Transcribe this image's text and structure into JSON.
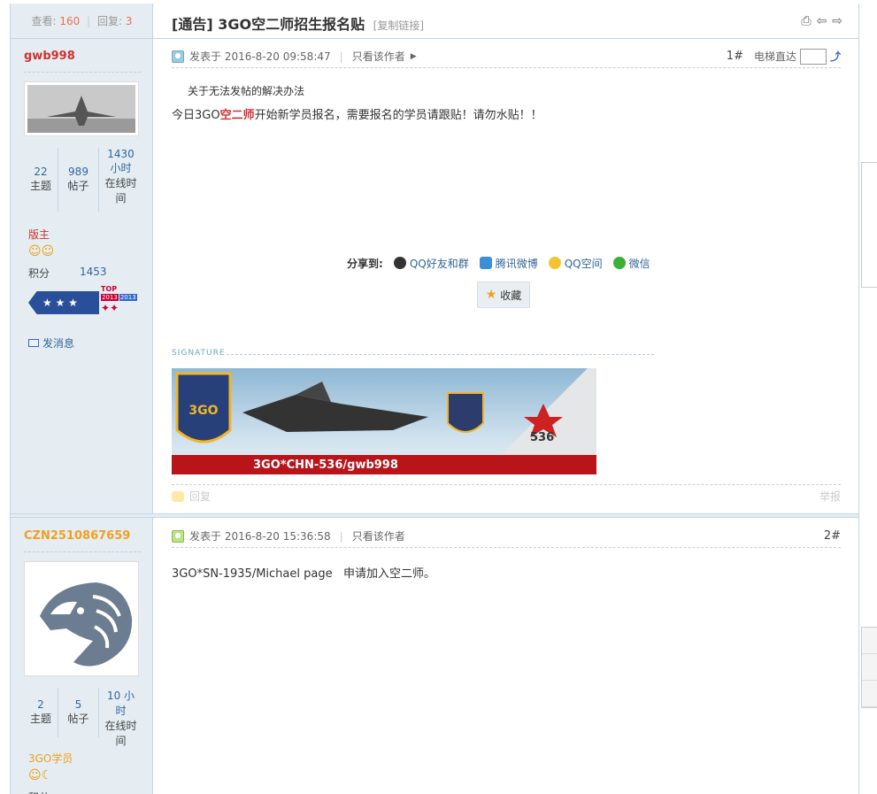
{
  "thread": {
    "views_label": "查看:",
    "views": "160",
    "replies_label": "回复:",
    "replies": "3",
    "tag": "[通告]",
    "title": "3GO空二师招生报名贴",
    "copy_link": "[复制链接]"
  },
  "posts": [
    {
      "author": "gwb998",
      "author_color": "#d03030",
      "stats": [
        {
          "value": "22",
          "label": "主题"
        },
        {
          "value": "989",
          "label": "帖子"
        },
        {
          "value": "1430 小时",
          "label": "在线时间"
        }
      ],
      "rank": "版主",
      "points_label": "积分",
      "points": "1453",
      "badge_labels": [
        "TOP",
        "2013",
        "2013"
      ],
      "message_label": "发消息",
      "posted": "发表于 2016-8-20 09:58:47",
      "only_author": "只看该作者",
      "floor": "1#",
      "elevator_label": "电梯直达",
      "body_title": "关于无法发帖的解决办法",
      "body_pre": "今日3GO",
      "body_highlight": "空二师",
      "body_post": "开始新学员报名，需要报名的学员请跟贴！请勿水贴！！",
      "share_label": "分享到:",
      "share_items": [
        "QQ好友和群",
        "腾讯微博",
        "QQ空间",
        "微信"
      ],
      "favorite": "收藏",
      "signature_label": "SIGNATURE",
      "banner_text": "3GO*CHN-536/gwb998",
      "banner_logo": "3GO",
      "banner_number": "536",
      "reply": "回复",
      "report": "举报"
    },
    {
      "author": "CZN2510867659",
      "author_color": "#f0a020",
      "stats": [
        {
          "value": "2",
          "label": "主题"
        },
        {
          "value": "5",
          "label": "帖子"
        },
        {
          "value": "10 小时",
          "label": "在线时间"
        }
      ],
      "rank": "3GO学员",
      "points_label": "积分",
      "posted": "发表于 2016-8-20 15:36:58",
      "only_author": "只看该作者",
      "floor": "2#",
      "body": "3GO*SN-1935/Michael page   申请加入空二师。"
    }
  ],
  "colors": {
    "sidebar": "#e5edf2",
    "border": "#c2d5e3",
    "link": "#336699",
    "highlight": "#d03030"
  }
}
